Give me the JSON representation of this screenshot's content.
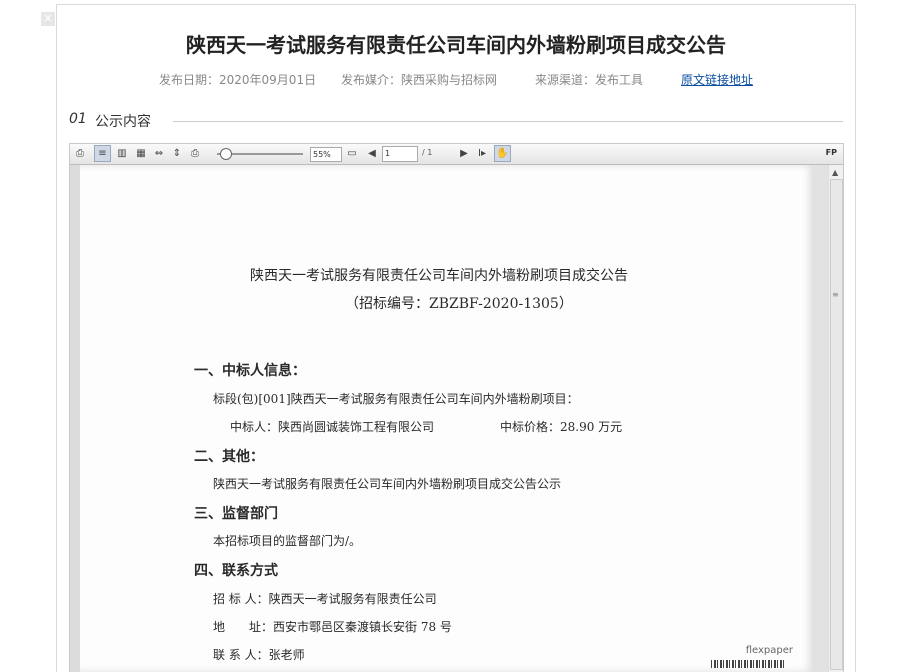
{
  "header": {
    "title": "陕西天一考试服务有限责任公司车间内外墙粉刷项目成交公告",
    "publish_date": "发布日期：2020年09月01日",
    "media": "发布媒介：陕西采购与招标网",
    "source": "来源渠道：发布工具",
    "original_link": "原文链接地址"
  },
  "section": {
    "number": "01",
    "label": "公示内容"
  },
  "viewer": {
    "zoom": "55%",
    "page_current": "1",
    "page_total": "/ 1",
    "brand_corner": "FP",
    "watermark": "flexpaper"
  },
  "document": {
    "title": "陕西天一考试服务有限责任公司车间内外墙粉刷项目成交公告",
    "code": "（招标编号：ZBZBF-2020-1305）",
    "s1_heading": "一、中标人信息：",
    "s1_line1": "标段(包)[001]陕西天一考试服务有限责任公司车间内外墙粉刷项目：",
    "s1_winner": "中标人：陕西尚圆诚装饰工程有限公司",
    "s1_price": "中标价格：28.90 万元",
    "s2_heading": "二、其他：",
    "s2_line": "陕西天一考试服务有限责任公司车间内外墙粉刷项目成交公告公示",
    "s3_heading": "三、监督部门",
    "s3_line": "本招标项目的监督部门为/。",
    "s4_heading": "四、联系方式",
    "s4_tenderer": "招 标 人：陕西天一考试服务有限责任公司",
    "s4_address": "地　　址：西安市鄠邑区秦渡镇长安街 78 号",
    "s4_contact": "联 系 人：张老师"
  },
  "icons": [
    "close-icon",
    "first-page-icon",
    "single-page-icon",
    "two-page-icon",
    "thumbnail-icon",
    "fit-width-icon",
    "fit-height-icon",
    "print-icon",
    "zoom-slider",
    "fullscreen-icon",
    "prev-page-icon",
    "next-page-icon",
    "text-select-icon",
    "hand-tool-icon"
  ]
}
